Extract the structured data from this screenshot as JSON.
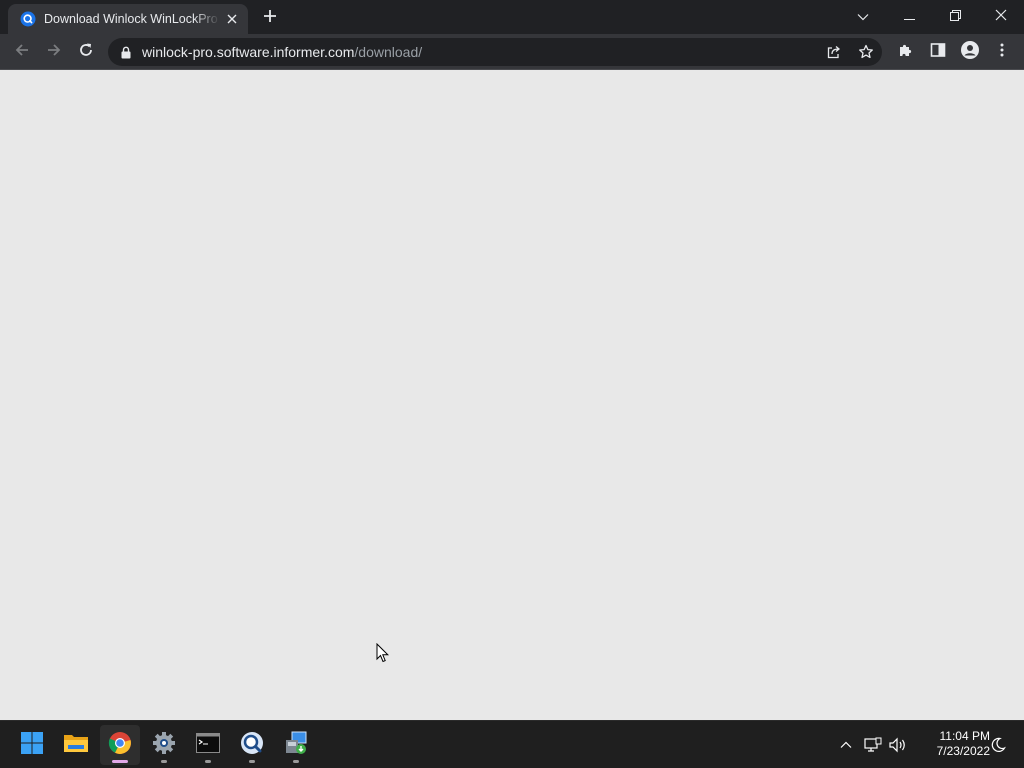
{
  "browser": {
    "tab": {
      "title": "Download Winlock WinLockPro by Crystal Office Systems",
      "favicon": "informer-q-icon"
    },
    "new_tab_icon": "plus-icon",
    "window_controls": [
      "chevron-down-icon",
      "minimize-icon",
      "restore-icon",
      "close-icon"
    ],
    "nav": {
      "back": "back-arrow-icon",
      "forward": "forward-arrow-icon",
      "reload": "reload-icon"
    },
    "address_bar": {
      "host": "winlock-pro.software.informer.com",
      "path": "/download/"
    },
    "omnibox_actions": [
      "share-icon",
      "bookmark-star-icon"
    ],
    "toolbar_actions": [
      "extensions-puzzle-icon",
      "side-panel-icon",
      "profile-icon",
      "menu-kebab-icon"
    ],
    "colors": {
      "titlebar": "#202124",
      "toolbar": "#35363a",
      "omnibox": "#202124",
      "page_background": "#e8e8e8"
    }
  },
  "taskbar": {
    "apps": [
      {
        "icon": "windows-start-icon",
        "active": false,
        "running": false
      },
      {
        "icon": "file-explorer-icon",
        "active": false,
        "running": false
      },
      {
        "icon": "chrome-icon",
        "active": true,
        "running": true
      },
      {
        "icon": "settings-gear-icon",
        "active": false,
        "running": true
      },
      {
        "icon": "terminal-icon",
        "active": false,
        "running": true
      },
      {
        "icon": "magnifier-app-icon",
        "active": false,
        "running": true
      },
      {
        "icon": "installer-app-icon",
        "active": false,
        "running": true
      }
    ],
    "tray": [
      "chevron-up-icon",
      "network-icon",
      "volume-icon"
    ],
    "time": "11:04 PM",
    "date": "7/23/2022",
    "notification_icon": "focus-moon-icon"
  }
}
